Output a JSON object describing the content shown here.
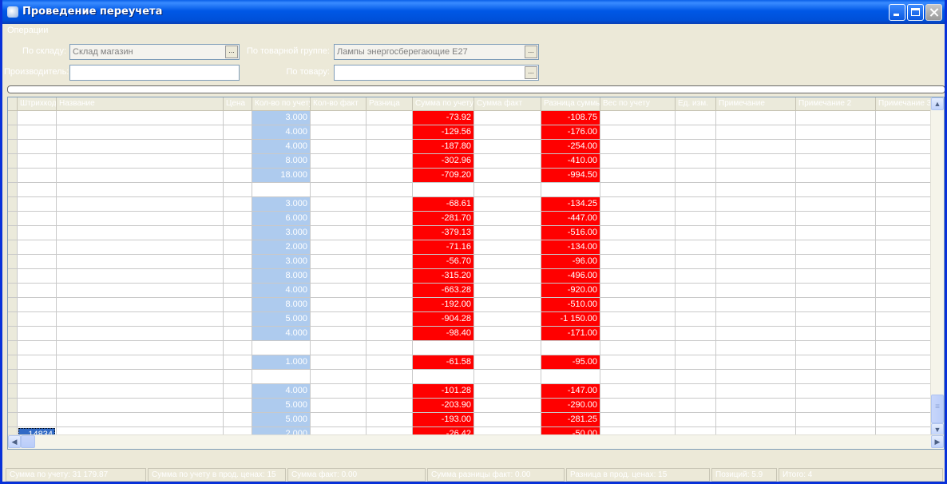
{
  "window": {
    "title": "Проведение переучета"
  },
  "menu": [
    {
      "label": "Операции"
    }
  ],
  "filters": {
    "warehouse_label": "По складу:",
    "warehouse_value": "Склад магазин",
    "group_label": "По товарной группе:",
    "group_value": "Лампы энергосберегающие Е27",
    "producer_label": "Производитель:",
    "producer_value": "",
    "product_label": "По товару:",
    "product_value": ""
  },
  "table": {
    "columns": [
      "Штрихкод",
      "Название",
      "Цена",
      "Кол-во по учету",
      "Кол-во факт",
      "Разница",
      "Сумма по учету",
      "Сумма факт",
      "Разница суммы",
      "Вес по учету",
      "Ед. изм.",
      "Примечание",
      "Примечание 2",
      "Примечание 3"
    ],
    "rows": [
      {
        "id": "",
        "qty": "3.000",
        "diff1": "-73.92",
        "diff2": "-108.75"
      },
      {
        "id": "",
        "qty": "4.000",
        "diff1": "-129.56",
        "diff2": "-176.00"
      },
      {
        "id": "",
        "qty": "4.000",
        "diff1": "-187.80",
        "diff2": "-254.00"
      },
      {
        "id": "",
        "qty": "8.000",
        "diff1": "-302.96",
        "diff2": "-410.00"
      },
      {
        "id": "",
        "qty": "18.000",
        "diff1": "-709.20",
        "diff2": "-994.50"
      },
      {
        "id": "",
        "qty": "",
        "diff1": "",
        "diff2": ""
      },
      {
        "id": "",
        "qty": "3.000",
        "diff1": "-68.61",
        "diff2": "-134.25"
      },
      {
        "id": "",
        "qty": "6.000",
        "diff1": "-281.70",
        "diff2": "-447.00"
      },
      {
        "id": "",
        "qty": "3.000",
        "diff1": "-379.13",
        "diff2": "-516.00"
      },
      {
        "id": "",
        "qty": "2.000",
        "diff1": "-71.16",
        "diff2": "-134.00"
      },
      {
        "id": "",
        "qty": "3.000",
        "diff1": "-56.70",
        "diff2": "-96.00"
      },
      {
        "id": "",
        "qty": "8.000",
        "diff1": "-315.20",
        "diff2": "-496.00"
      },
      {
        "id": "",
        "qty": "4.000",
        "diff1": "-663.28",
        "diff2": "-920.00"
      },
      {
        "id": "",
        "qty": "8.000",
        "diff1": "-192.00",
        "diff2": "-510.00"
      },
      {
        "id": "",
        "qty": "5.000",
        "diff1": "-904.28",
        "diff2": "-1 150.00"
      },
      {
        "id": "",
        "qty": "4.000",
        "diff1": "-98.40",
        "diff2": "-171.00"
      },
      {
        "id": "",
        "qty": "",
        "diff1": "",
        "diff2": ""
      },
      {
        "id": "",
        "qty": "1.000",
        "diff1": "-61.58",
        "diff2": "-95.00"
      },
      {
        "id": "",
        "qty": "",
        "diff1": "",
        "diff2": ""
      },
      {
        "id": "",
        "qty": "4.000",
        "diff1": "-101.28",
        "diff2": "-147.00"
      },
      {
        "id": "",
        "qty": "5.000",
        "diff1": "-203.90",
        "diff2": "-290.00"
      },
      {
        "id": "",
        "qty": "5.000",
        "diff1": "-193.00",
        "diff2": "-281.25"
      },
      {
        "id": "14834",
        "qty": "2.000",
        "diff1": "-26.42",
        "diff2": "-50.00"
      }
    ],
    "selected_row_index": 22
  },
  "statusbar": [
    {
      "text": "Сумма по учету: 31 179.87"
    },
    {
      "text": "Сумма по учету в прод. ценах: 15"
    },
    {
      "text": "Сумма факт: 0.00"
    },
    {
      "text": "Сумма разницы факт: 0.00"
    },
    {
      "text": "Разница в прод. ценах: 15"
    },
    {
      "text": "Позиций: 5.9"
    },
    {
      "text": "Итого: 4"
    }
  ],
  "colors": {
    "titlebar": "#0054e3",
    "qty_fill": "#aecbee",
    "diff_fill": "#ff0000",
    "selection": "#316ac5"
  }
}
